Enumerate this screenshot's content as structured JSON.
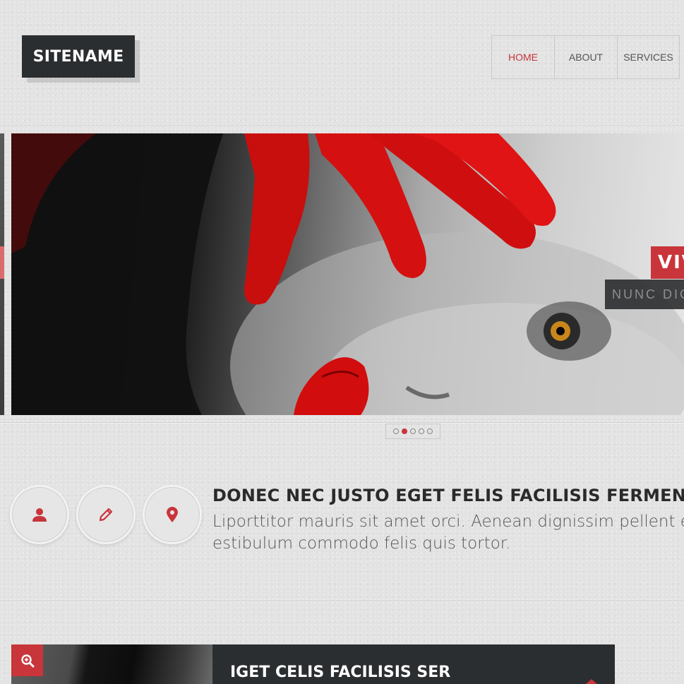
{
  "header": {
    "logo": "SITENAME",
    "nav": [
      {
        "label": "HOME",
        "active": true
      },
      {
        "label": "ABOUT",
        "active": false
      },
      {
        "label": "SERVICES",
        "active": false
      }
    ]
  },
  "slider": {
    "caption_title": "VIV",
    "caption_subtitle": "NUNC DIG",
    "dots": 5,
    "active_dot": 1
  },
  "feature": {
    "icons": [
      "user-icon",
      "pencil-icon",
      "map-marker-icon"
    ],
    "headline": "DONEC NEC JUSTO EGET FELIS FACILISIS FERMENTU",
    "body_line1": "Liporttitor mauris sit amet orci. Aenean dignissim pellent e",
    "body_line2": "estibulum commodo felis quis tortor."
  },
  "bottom_card": {
    "title": "IGET CELIS FACILISIS SER"
  },
  "colors": {
    "accent": "#c8353a",
    "dark": "#2b2e31",
    "background": "#e3e3e3"
  }
}
